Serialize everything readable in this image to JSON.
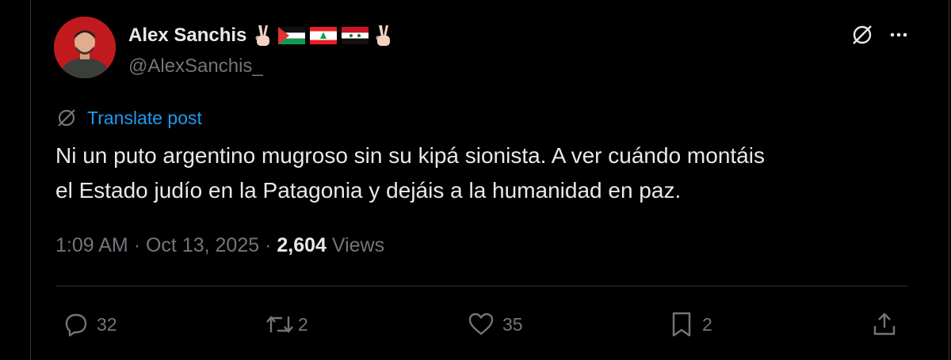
{
  "author": {
    "display_name": "Alex Sanchis",
    "handle": "@AlexSanchis_",
    "name_emojis": [
      "victory-hand",
      "flag-palestine",
      "flag-lebanon",
      "flag-syria",
      "victory-hand"
    ]
  },
  "translate": {
    "label": "Translate post"
  },
  "post": {
    "text_line_1": "Ni un puto argentino mugroso sin su kipá sionista. A ver cuándo montáis",
    "text_line_2": "el Estado judío en la Patagonia y dejáis a la humanidad en paz."
  },
  "meta": {
    "time": "1:09 AM",
    "separator": "·",
    "date": "Oct 13, 2025",
    "views_count": "2,604",
    "views_label": "Views"
  },
  "actions": {
    "replies": "32",
    "reposts": "2",
    "likes": "35",
    "bookmarks": "2"
  },
  "colors": {
    "background": "#000000",
    "text": "#e7e9ea",
    "muted": "#71767b",
    "link": "#1d9bf0",
    "border": "#2f3336"
  }
}
